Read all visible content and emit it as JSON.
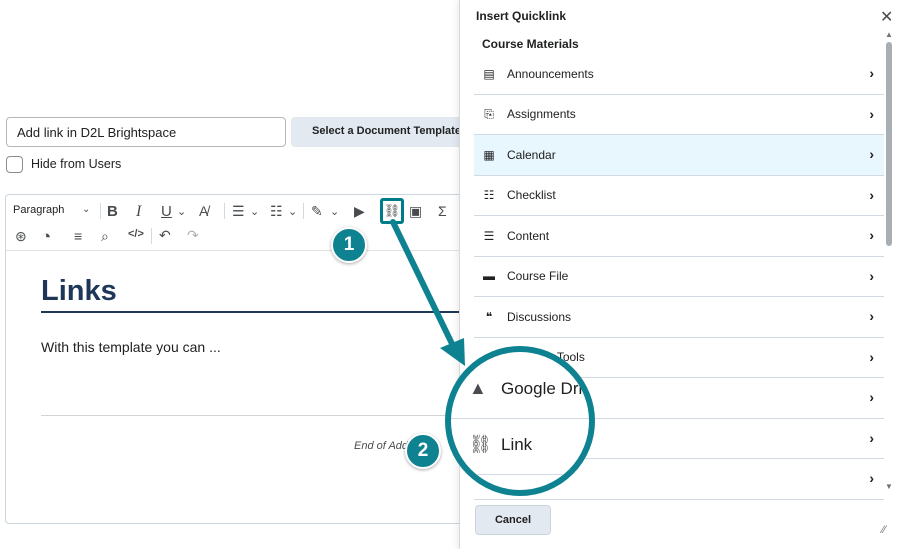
{
  "editor": {
    "title_value": "Add link in D2L Brightspace",
    "template_button": "Select a Document Template",
    "hide_label": "Hide from Users",
    "toolbar": {
      "paragraph_label": "Paragraph",
      "bold": "B",
      "italic": "I",
      "underline": "U"
    },
    "document": {
      "heading": "Links",
      "body": "With this template you can ...",
      "end_text": "End of Add"
    }
  },
  "quicklink": {
    "title": "Insert Quicklink",
    "section": "Course Materials",
    "items": [
      {
        "label": "Announcements",
        "icon": "announcements-icon",
        "glyph": "▤"
      },
      {
        "label": "Assignments",
        "icon": "assignments-icon",
        "glyph": "⎘"
      },
      {
        "label": "Calendar",
        "icon": "calendar-icon",
        "glyph": "▦"
      },
      {
        "label": "Checklist",
        "icon": "checklist-icon",
        "glyph": "☷"
      },
      {
        "label": "Content",
        "icon": "content-icon",
        "glyph": "☰"
      },
      {
        "label": "Course File",
        "icon": "folder-icon",
        "glyph": "▬"
      },
      {
        "label": "Discussions",
        "icon": "discussions-icon",
        "glyph": "❝"
      },
      {
        "label": "Learning Tools",
        "icon": "learning-tools-icon",
        "glyph": ""
      },
      {
        "label": "",
        "icon": "",
        "glyph": ""
      },
      {
        "label": "",
        "icon": "",
        "glyph": ""
      },
      {
        "label": "",
        "icon": "",
        "glyph": ""
      }
    ],
    "selected_index": 2,
    "cancel_label": "Cancel"
  },
  "annotations": {
    "step1": "1",
    "step2": "2",
    "magnified": [
      {
        "label": "Google Driv",
        "icon": "google-drive-icon",
        "glyph": "▲"
      },
      {
        "label": "Link",
        "icon": "link-icon",
        "glyph": "⛓"
      }
    ],
    "accent_color": "#0f8291"
  }
}
